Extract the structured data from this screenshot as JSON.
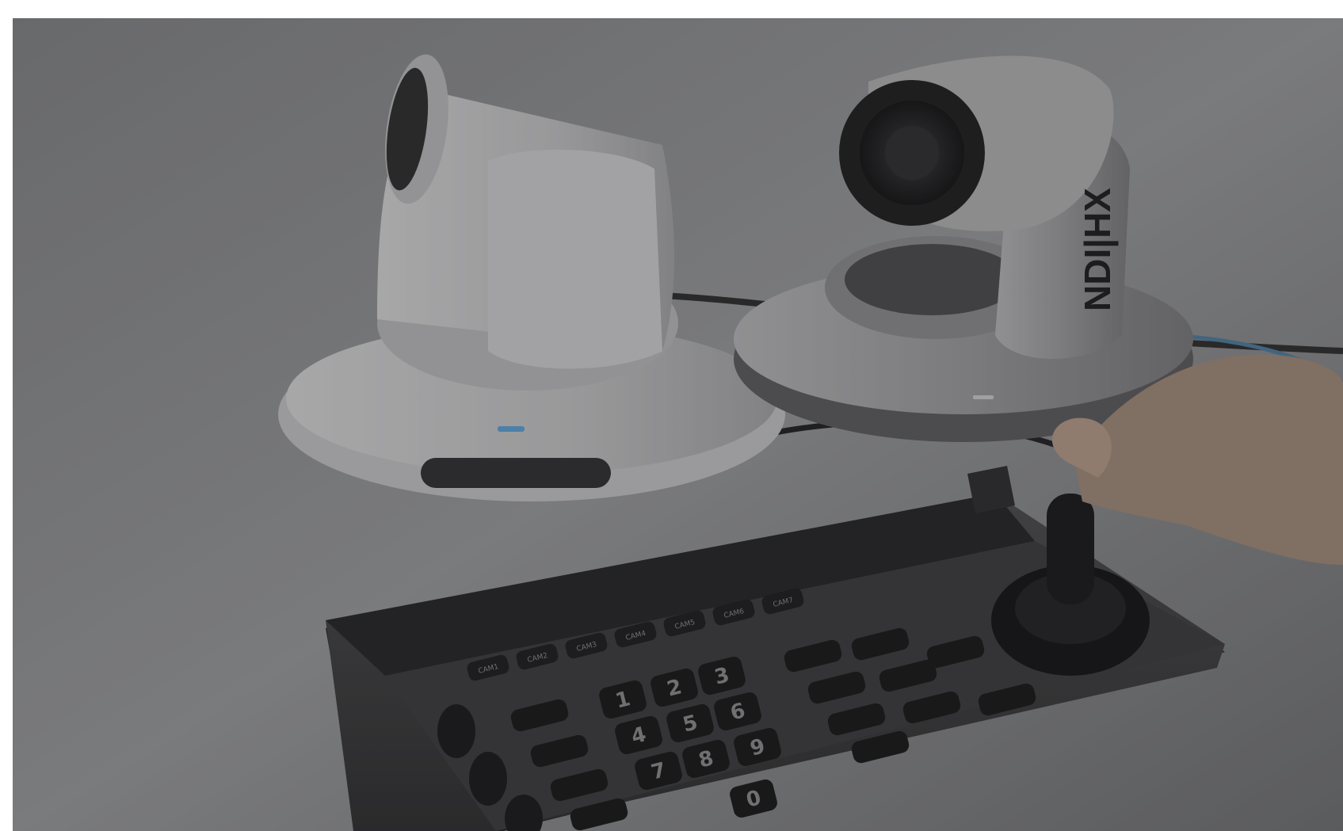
{
  "scene": {
    "background_color": "#8e8e90",
    "overlay_color": "#2b2b2b",
    "camera_right_text": "NDI|HX",
    "keypad_keys": [
      "1",
      "2",
      "3",
      "4",
      "5",
      "6",
      "7",
      "8",
      "9",
      "0"
    ],
    "cam_keys": [
      "CAM1",
      "CAM2",
      "CAM3",
      "CAM4",
      "CAM5",
      "CAM6",
      "CAM7"
    ]
  }
}
